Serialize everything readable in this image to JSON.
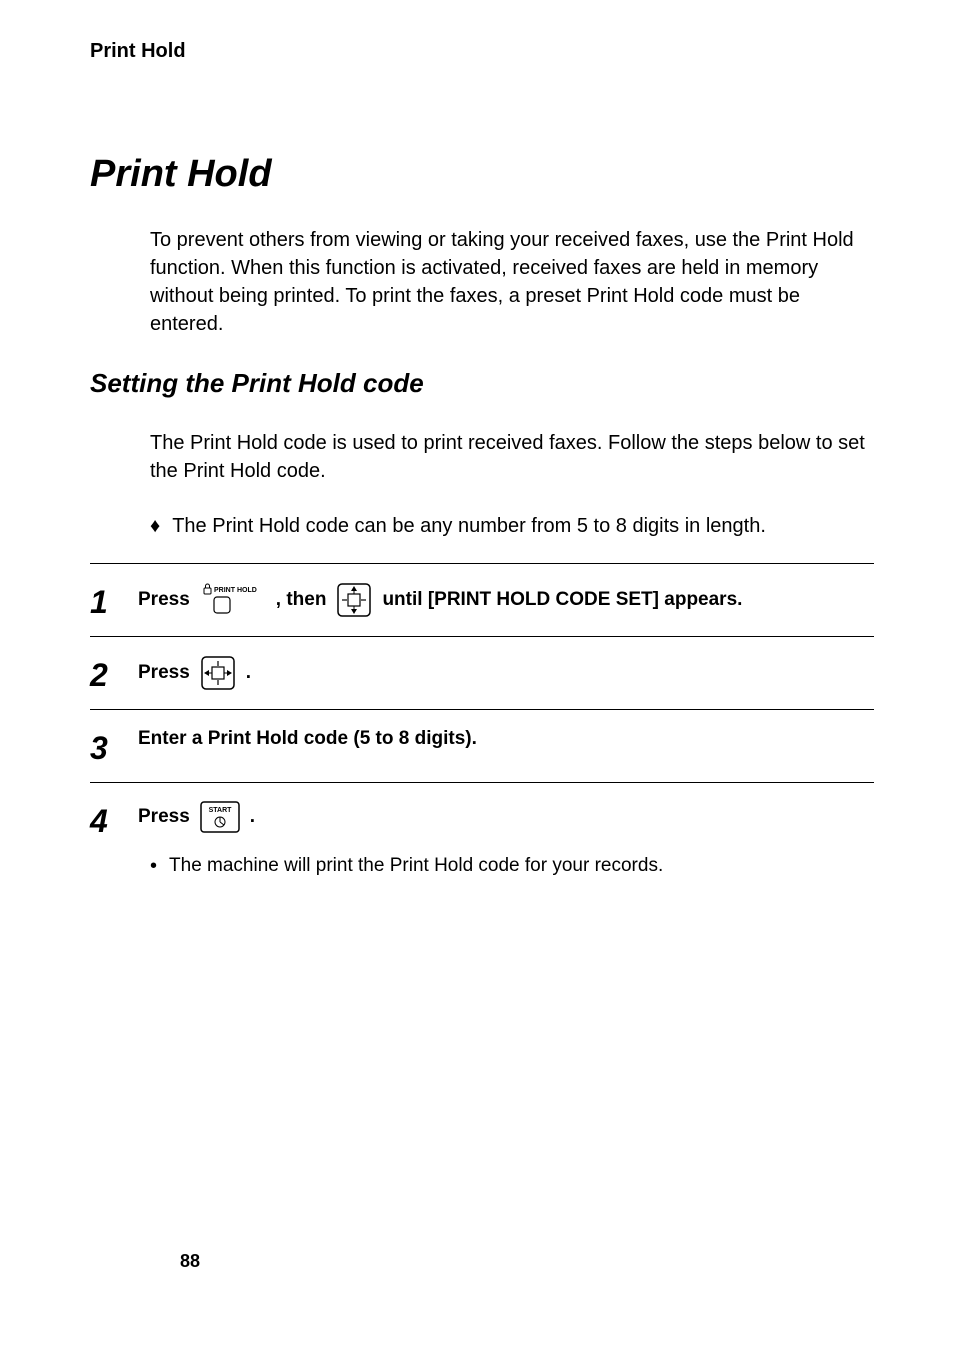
{
  "header": "Print Hold",
  "title": "Print Hold",
  "intro": "To prevent others from viewing or taking your received faxes, use the Print Hold function. When this function is activated, received faxes are held in memory without being printed. To print the faxes, a preset Print Hold code must be entered.",
  "subtitle": "Setting the Print Hold code",
  "para2": "The Print Hold code is used to print received faxes. Follow the steps below to set the Print Hold code.",
  "diamond_bullet": "The Print Hold code can be any number from 5 to 8 digits in length.",
  "steps": {
    "s1": {
      "num": "1",
      "press": "Press",
      "print_hold_label": "PRINT HOLD",
      "then": ", then",
      "until": "until [PRINT HOLD CODE SET] appears."
    },
    "s2": {
      "num": "2",
      "press": "Press",
      "period": "."
    },
    "s3": {
      "num": "3",
      "text": "Enter a Print Hold code (5 to 8 digits)."
    },
    "s4": {
      "num": "4",
      "press": "Press",
      "start_label": "START",
      "period": ".",
      "bullet": "The machine will print the Print Hold code for your records."
    }
  },
  "page_number": "88"
}
